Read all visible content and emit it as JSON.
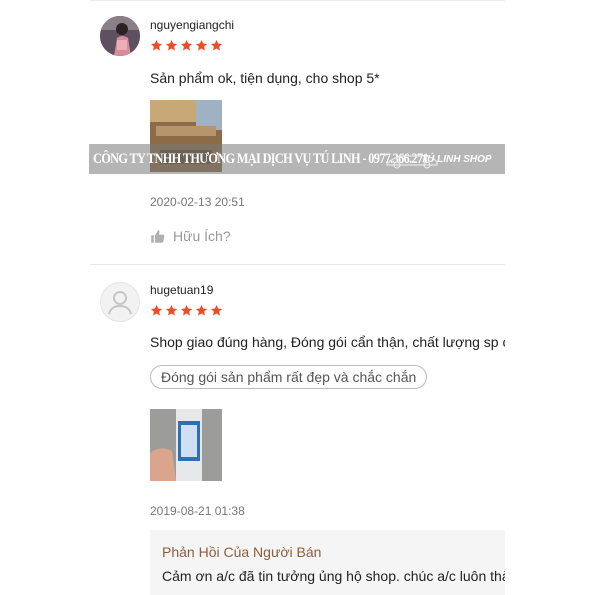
{
  "reviews": [
    {
      "username": "nguyengiangchi",
      "rating": 5,
      "comment": "Sản phẩm ok, tiện dụng, cho shop 5*",
      "date": "2020-02-13 20:51",
      "helpful_label": "Hữu Ích?"
    },
    {
      "username": "hugetuan19",
      "rating": 5,
      "comment": "Shop giao đúng hàng, Đóng gói cẩn thận, chất lượng sp c",
      "tag": "Đóng gói sản phẩm rất đẹp và chắc chắn",
      "date": "2019-08-21 01:38",
      "seller_reply": {
        "title": "Phản Hồi Của Người Bán",
        "text": "Cảm ơn a/c đã tin tưởng ủng hộ shop. chúc a/c luôn thà"
      }
    }
  ],
  "watermark": {
    "text": "CÔNG TY TNHH THƯƠNG MẠI DỊCH VỤ TÚ LINH - 0977.366.271",
    "logo": "TÚ LINH SHOP"
  },
  "colors": {
    "star": "#ee4d2d",
    "reply_title": "#8b5e3c",
    "meta": "#777777"
  },
  "icons": {
    "helpful": "thumbs-up-icon",
    "avatar_placeholder": "user-icon",
    "rating": "star-icon"
  }
}
